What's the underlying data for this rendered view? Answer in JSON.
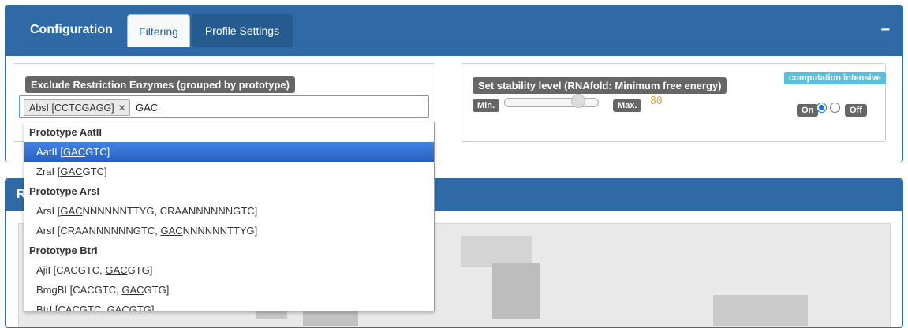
{
  "config": {
    "title": "Configuration",
    "tabs": [
      {
        "label": "Filtering",
        "active": true
      },
      {
        "label": "Profile Settings",
        "active": false
      }
    ],
    "collapse_symbol": "−"
  },
  "exclude": {
    "label": "Exclude Restriction Enzymes (grouped by prototype)",
    "selected_tag": "AbsI [CCTCGAGG]",
    "typed_text": "GAC"
  },
  "stability": {
    "label": "Set stability level (RNAfold: Minimum free energy)",
    "badge": "computation intensive",
    "min_label": "Min.",
    "max_label": "Max.",
    "value": "80",
    "slider_fraction": 0.78,
    "on_label": "On",
    "off_label": "Off",
    "selected": "on"
  },
  "second_panel": {
    "title": "R"
  },
  "dropdown": {
    "rows": [
      {
        "type": "group",
        "text": "Prototype AatII"
      },
      {
        "type": "option",
        "highlight": true,
        "pre": "AatII [",
        "match": "GAC",
        "post": "GTC]"
      },
      {
        "type": "option",
        "pre": "ZraI [",
        "match": "GAC",
        "post": "GTC]"
      },
      {
        "type": "group",
        "text": "Prototype ArsI"
      },
      {
        "type": "option",
        "pre": "ArsI [",
        "match": "GAC",
        "post": "NNNNNNTTYG, CRAANNNNNNGTC]"
      },
      {
        "type": "option",
        "pre": "ArsI [CRAANNNNNNGTC, ",
        "match": "GAC",
        "post": "NNNNNNTTYG]"
      },
      {
        "type": "group",
        "text": "Prototype BtrI"
      },
      {
        "type": "option",
        "pre": "AjiI [CACGTC, ",
        "match": "GAC",
        "post": "GTG]"
      },
      {
        "type": "option",
        "pre": "BmgBI [CACGTC, ",
        "match": "GAC",
        "post": "GTG]"
      },
      {
        "type": "option",
        "pre": "BtrI [CACGTC, ",
        "match": "GAC",
        "post": "GTG]"
      }
    ]
  },
  "colors": {
    "header_blue": "#2f6aa6",
    "highlight_blue": "#3875d7",
    "value_orange": "#e8a33d",
    "badge_cyan": "#5bc0de"
  }
}
